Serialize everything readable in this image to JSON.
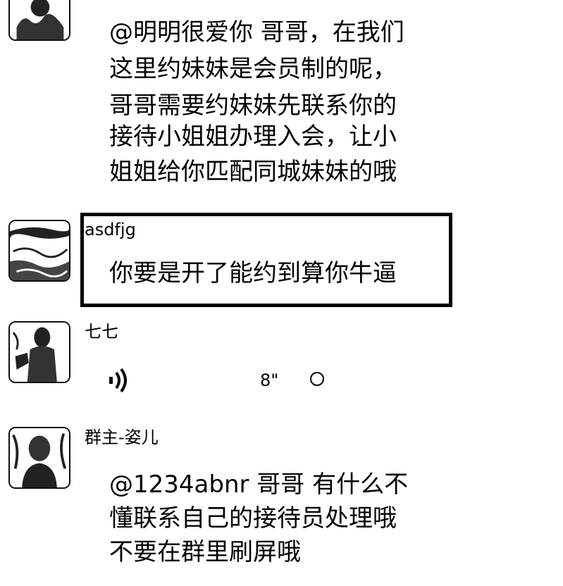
{
  "messages": [
    {
      "sender": "",
      "lines": [
        "@明明很爱你 哥哥，在我们",
        "这里约妹妹是会员制的呢，",
        "哥哥需要约妹妹先联系你的",
        "接待小姐姐办理入会，让小",
        "姐姐给你匹配同城妹妹的哦"
      ]
    },
    {
      "sender": "asdfjg",
      "lines": [
        "你要是开了能约到算你牛逼"
      ]
    },
    {
      "sender": "七七",
      "voice": {
        "icon": "voice-wave-icon",
        "duration": "8\"",
        "status_icon": "unread-circle-icon"
      }
    },
    {
      "sender": "群主-姿儿",
      "lines": [
        "@1234abnr   哥哥 有什么不",
        "懂联系自己的接待员处理哦",
        "不要在群里刷屏哦"
      ]
    }
  ]
}
